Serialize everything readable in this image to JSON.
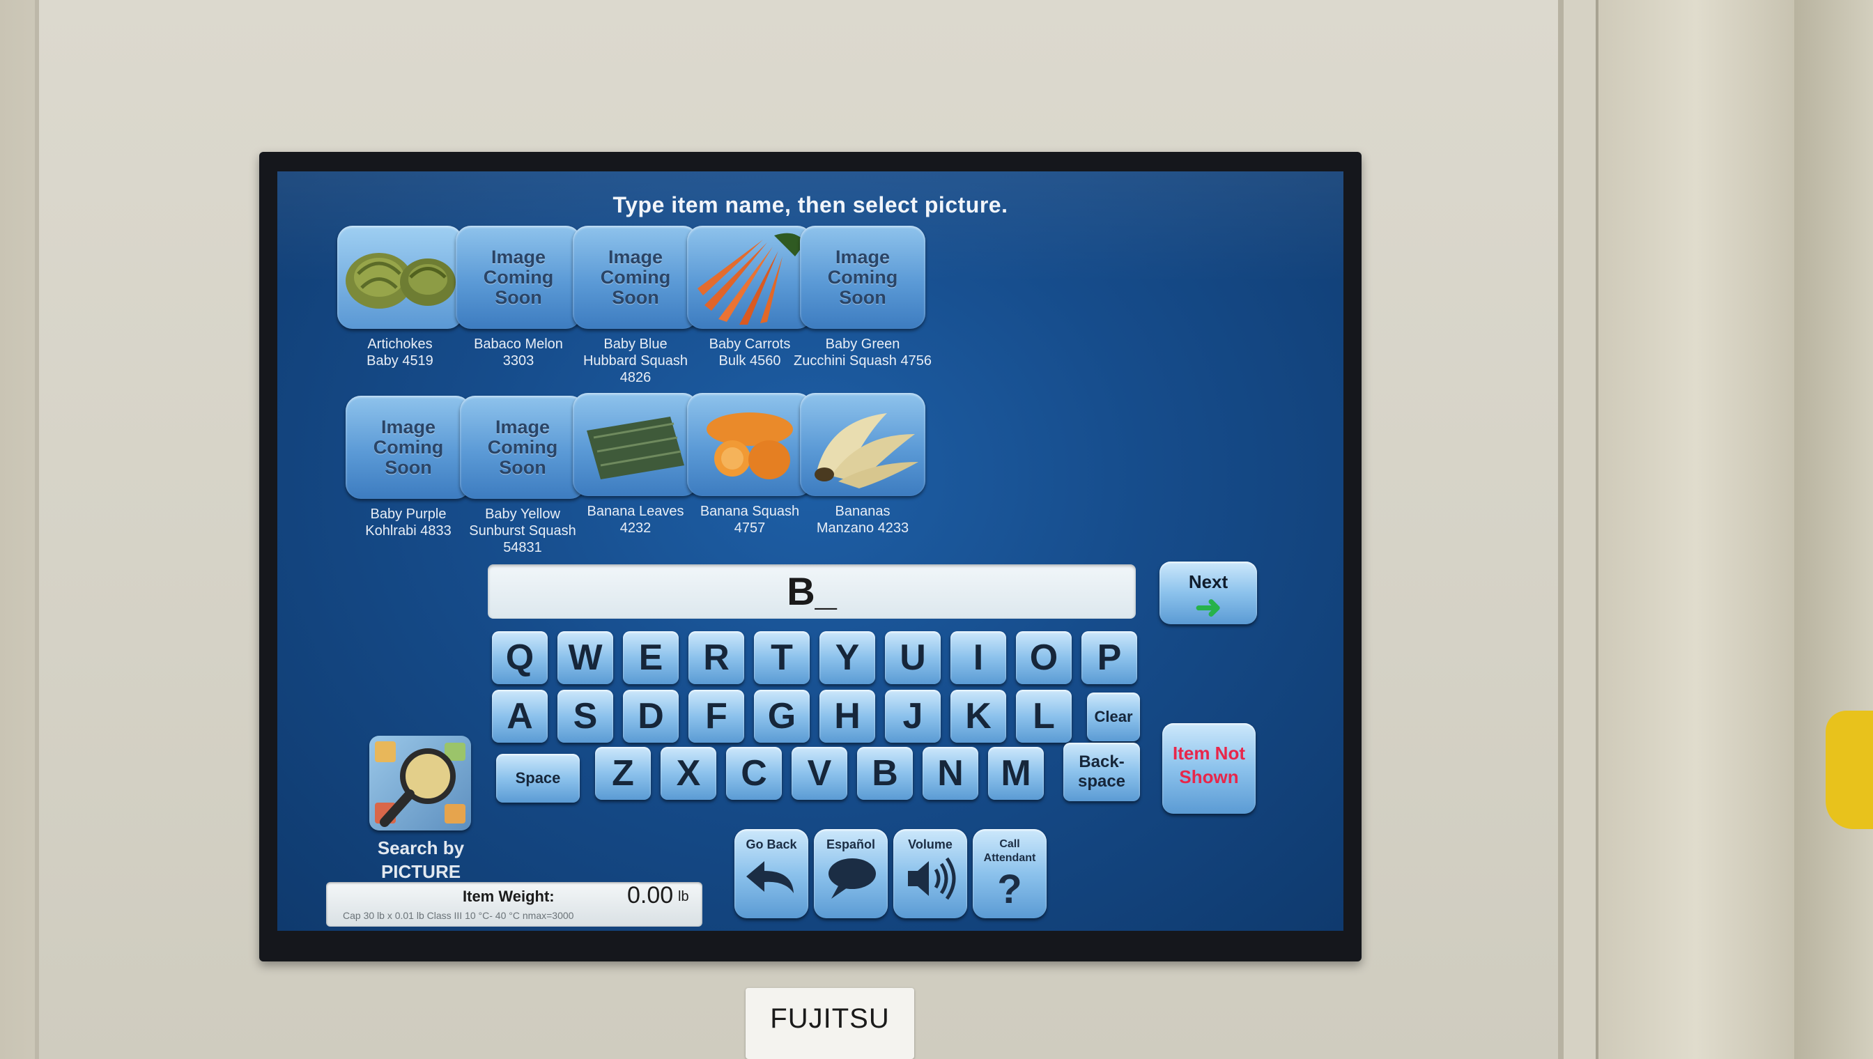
{
  "header": {
    "title": "Type item name, then select picture."
  },
  "items": [
    {
      "label": "Artichokes\nBaby  4519",
      "image": "artichoke"
    },
    {
      "label": "Babaco Melon\n3303",
      "image": "coming-soon"
    },
    {
      "label": "Baby Blue\nHubbard Squash  4826",
      "image": "coming-soon"
    },
    {
      "label": "Baby Carrots\nBulk  4560",
      "image": "carrots"
    },
    {
      "label": "Baby Green\nZucchini Squash  4756",
      "image": "coming-soon"
    },
    {
      "label": "Baby Purple\nKohlrabi  4833",
      "image": "coming-soon"
    },
    {
      "label": "Baby Yellow\nSunburst Squash  54831",
      "image": "coming-soon"
    },
    {
      "label": "Banana Leaves\n4232",
      "image": "banana-leaves"
    },
    {
      "label": "Banana Squash\n4757",
      "image": "banana-squash"
    },
    {
      "label": "Bananas\nManzano  4233",
      "image": "bananas"
    }
  ],
  "placeholder_text": "Image\nComing\nSoon",
  "entry": {
    "value": "B_"
  },
  "keyboard": {
    "row1": [
      "Q",
      "W",
      "E",
      "R",
      "T",
      "Y",
      "U",
      "I",
      "O",
      "P"
    ],
    "row2": [
      "A",
      "S",
      "D",
      "F",
      "G",
      "H",
      "J",
      "K",
      "L"
    ],
    "row3": [
      "Z",
      "X",
      "C",
      "V",
      "B",
      "N",
      "M"
    ],
    "clear": "Clear",
    "space": "Space",
    "backspace": "Back-\nspace"
  },
  "next_button": {
    "label": "Next",
    "icon": "green-arrow-right-icon"
  },
  "item_not_shown": {
    "label": "Item Not\nShown"
  },
  "search_by_picture": {
    "label": "Search by\nPICTURE",
    "icon": "magnifier-icon"
  },
  "weight": {
    "label": "Item Weight:",
    "value": "0.00",
    "unit": "lb",
    "capacity": "Cap 30 lb x 0.01 lb Class III  10 °C- 40 °C  nmax=3000"
  },
  "tools": [
    {
      "label": "Go Back",
      "icon": "back-arrow-icon"
    },
    {
      "label": "Español",
      "icon": "speech-bubble-icon"
    },
    {
      "label": "Volume",
      "icon": "speaker-icon"
    },
    {
      "label": "Call\nAttendant",
      "icon": "question-mark-icon"
    }
  ],
  "device_brand": "FUJITSU",
  "colors": {
    "screen_bg": "#164c8b",
    "button_light": "#cde8fb",
    "button_dark": "#5b9bd4",
    "next_arrow": "#27b24a",
    "not_shown_text": "#e8264a"
  }
}
